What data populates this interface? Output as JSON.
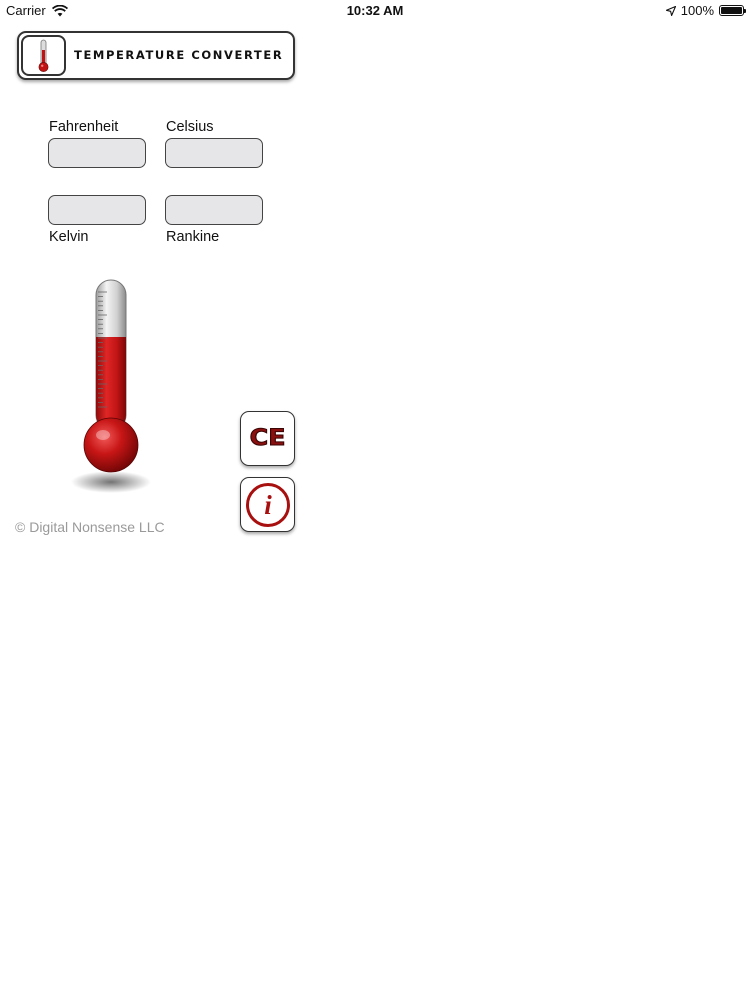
{
  "status_bar": {
    "carrier": "Carrier",
    "time": "10:32 AM",
    "battery": "100%",
    "battery_level": 1.0,
    "icons": [
      "wifi-icon",
      "location-arrow-icon",
      "battery-icon"
    ]
  },
  "header": {
    "title": "TEMPERATURE CONVERTER",
    "icon": "thermometer-icon"
  },
  "fields": {
    "fahrenheit": {
      "label": "Fahrenheit",
      "value": ""
    },
    "celsius": {
      "label": "Celsius",
      "value": ""
    },
    "kelvin": {
      "label": "Kelvin",
      "value": ""
    },
    "rankine": {
      "label": "Rankine",
      "value": ""
    }
  },
  "thermometer": {
    "fill_level": 0.62
  },
  "buttons": {
    "clear_label": "CE",
    "info_label": "i"
  },
  "footer": {
    "copyright": "© Digital Nonsense LLC"
  },
  "colors": {
    "accent_red": "#a81010",
    "field_bg": "#e6e6e9",
    "copyright_gray": "#9a9a9a"
  }
}
